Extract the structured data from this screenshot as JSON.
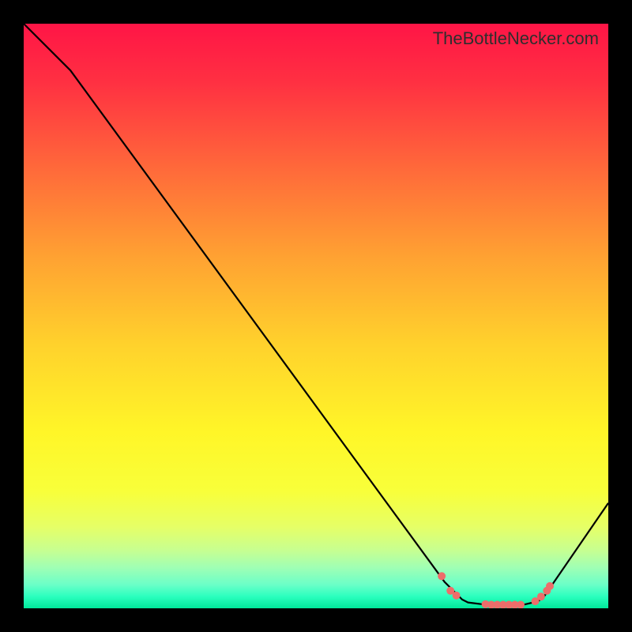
{
  "label": "TheBottleNecker.com",
  "chart_data": {
    "type": "line",
    "title": "",
    "xlabel": "",
    "ylabel": "",
    "xlim": [
      0,
      100
    ],
    "ylim": [
      0,
      100
    ],
    "series": [
      {
        "name": "curve",
        "x": [
          0,
          8,
          72,
          75,
          76,
          80,
          85,
          88,
          89,
          100
        ],
        "y": [
          100,
          92,
          4.5,
          1.5,
          1,
          0.5,
          0.5,
          1.2,
          2,
          18
        ]
      }
    ],
    "dots": {
      "x": [
        71.5,
        73,
        74,
        79,
        80,
        81,
        82,
        83,
        84,
        85,
        87.5,
        88.5,
        89.5,
        90
      ],
      "y": [
        5.5,
        3,
        2.2,
        0.7,
        0.6,
        0.6,
        0.6,
        0.6,
        0.6,
        0.6,
        1.2,
        2,
        3,
        3.8
      ],
      "color": "#ed6d6a"
    },
    "gradient_stops": [
      {
        "p": 0,
        "c": "#ff1546"
      },
      {
        "p": 10,
        "c": "#ff3042"
      },
      {
        "p": 25,
        "c": "#ff6a3a"
      },
      {
        "p": 40,
        "c": "#ffa232"
      },
      {
        "p": 55,
        "c": "#ffd22c"
      },
      {
        "p": 70,
        "c": "#fff628"
      },
      {
        "p": 80,
        "c": "#f8ff3a"
      },
      {
        "p": 86,
        "c": "#e6ff66"
      },
      {
        "p": 90,
        "c": "#c8ff90"
      },
      {
        "p": 93,
        "c": "#a0ffb4"
      },
      {
        "p": 96,
        "c": "#6affc8"
      },
      {
        "p": 98,
        "c": "#2affbe"
      },
      {
        "p": 100,
        "c": "#00e89a"
      }
    ]
  }
}
